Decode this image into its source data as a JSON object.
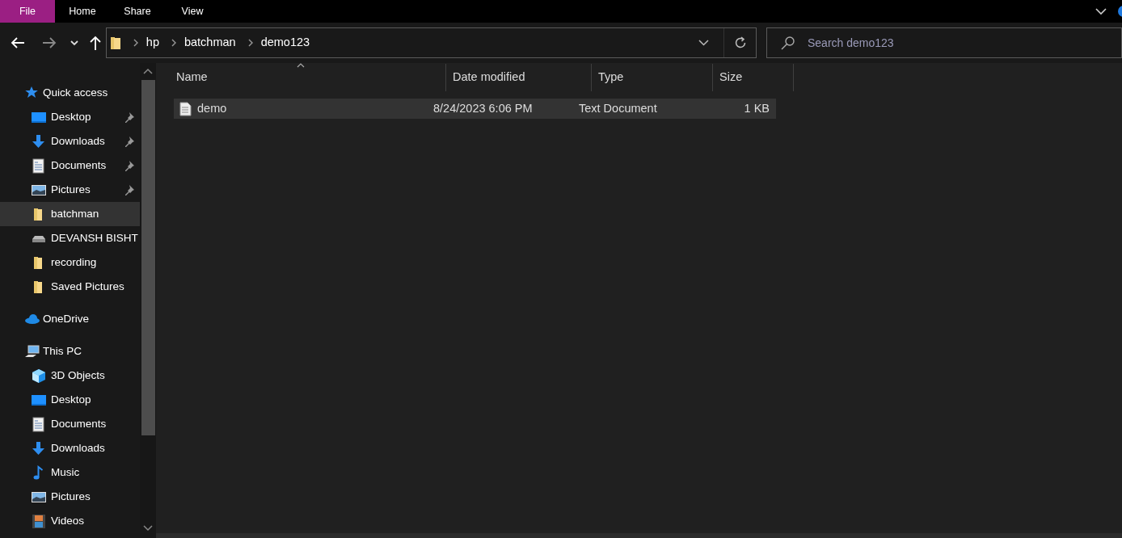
{
  "ribbon": {
    "tabs": [
      {
        "label": "File",
        "selected": true
      },
      {
        "label": "Home",
        "selected": false
      },
      {
        "label": "Share",
        "selected": false
      },
      {
        "label": "View",
        "selected": false
      }
    ]
  },
  "address": {
    "crumbs": [
      "hp",
      "batchman",
      "demo123"
    ]
  },
  "search": {
    "placeholder": "Search demo123"
  },
  "sidebar": {
    "groups": [
      {
        "label": "Quick access",
        "kind": "star",
        "selected": false,
        "children": [
          {
            "label": "Desktop",
            "kind": "desktop",
            "pinned": true,
            "selected": false
          },
          {
            "label": "Downloads",
            "kind": "download",
            "pinned": true,
            "selected": false
          },
          {
            "label": "Documents",
            "kind": "document",
            "pinned": true,
            "selected": false
          },
          {
            "label": "Pictures",
            "kind": "pictures",
            "pinned": true,
            "selected": false
          },
          {
            "label": "batchman",
            "kind": "folder",
            "pinned": false,
            "selected": true
          },
          {
            "label": "DEVANSH BISHT",
            "kind": "drive",
            "pinned": false,
            "selected": false
          },
          {
            "label": "recording",
            "kind": "folder",
            "pinned": false,
            "selected": false
          },
          {
            "label": "Saved Pictures",
            "kind": "folder",
            "pinned": false,
            "selected": false
          }
        ]
      },
      {
        "label": "OneDrive",
        "kind": "cloud",
        "selected": false
      },
      {
        "label": "This PC",
        "kind": "pc",
        "selected": false,
        "children": [
          {
            "label": "3D Objects",
            "kind": "cube",
            "pinned": false,
            "selected": false
          },
          {
            "label": "Desktop",
            "kind": "desktop",
            "pinned": false,
            "selected": false
          },
          {
            "label": "Documents",
            "kind": "document",
            "pinned": false,
            "selected": false
          },
          {
            "label": "Downloads",
            "kind": "download",
            "pinned": false,
            "selected": false
          },
          {
            "label": "Music",
            "kind": "music",
            "pinned": false,
            "selected": false
          },
          {
            "label": "Pictures",
            "kind": "pictures",
            "pinned": false,
            "selected": false
          },
          {
            "label": "Videos",
            "kind": "video",
            "pinned": false,
            "selected": false
          }
        ]
      }
    ]
  },
  "files": {
    "columns": [
      {
        "label": "Name",
        "sorted": true
      },
      {
        "label": "Date modified",
        "sorted": false
      },
      {
        "label": "Type",
        "sorted": false
      },
      {
        "label": "Size",
        "sorted": false
      }
    ],
    "rows": [
      {
        "name": "demo",
        "date": "8/24/2023 6:06 PM",
        "type": "Text Document",
        "size": "1 KB",
        "selected": true
      }
    ]
  }
}
